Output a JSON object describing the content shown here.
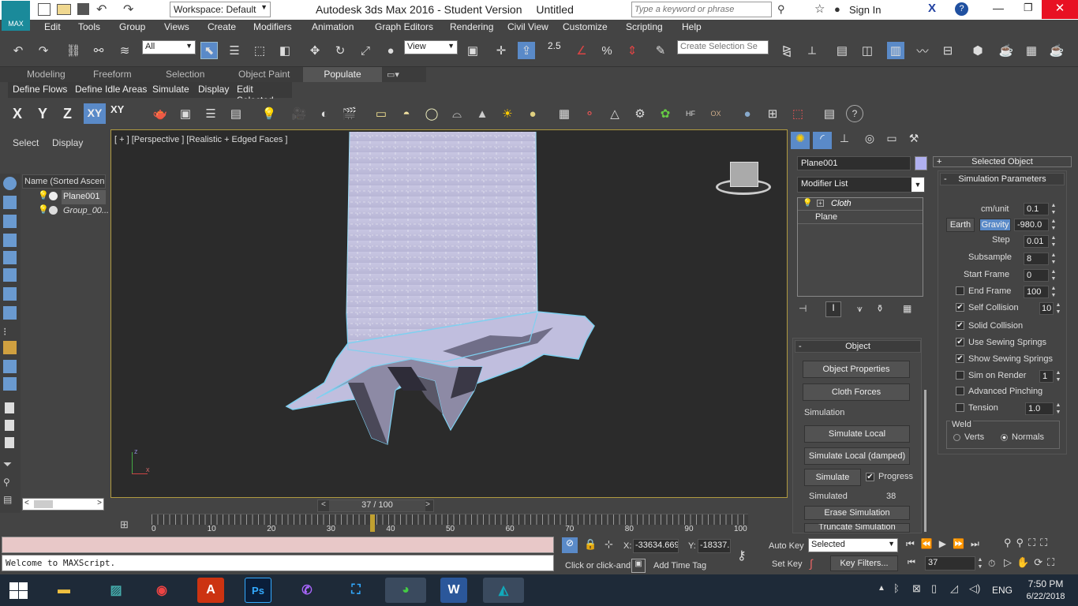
{
  "title_bar": {
    "workspace_label": "Workspace: Default",
    "app_title": "Autodesk 3ds Max 2016 - Student Version",
    "file_name": "Untitled",
    "search_placeholder": "Type a keyword or phrase",
    "sign_in": "Sign In",
    "app_logo": "MAX"
  },
  "menu": [
    "Edit",
    "Tools",
    "Group",
    "Views",
    "Create",
    "Modifiers",
    "Animation",
    "Graph Editors",
    "Rendering",
    "Civil View",
    "Customize",
    "Scripting",
    "Help"
  ],
  "toolbar": {
    "filter_value": "All",
    "refcoord_value": "View",
    "selection_set_placeholder": "Create Selection Se",
    "snap_label": "2.5"
  },
  "ribbon": {
    "tabs": [
      "Modeling",
      "Freeform",
      "Selection",
      "Object Paint",
      "Populate"
    ],
    "active_tab": "Populate",
    "sub_items": [
      "Define Flows",
      "Define Idle Areas",
      "Simulate",
      "Display",
      "Edit Selected"
    ]
  },
  "axis_constraints": [
    "X",
    "Y",
    "Z",
    "XY",
    "XY"
  ],
  "scene_explorer": {
    "tabs": [
      "Select",
      "Display"
    ],
    "column_header": "Name (Sorted Ascend",
    "items": [
      "Plane001",
      "Group_00..."
    ]
  },
  "viewport": {
    "label": "[ + ] [Perspective ] [Realistic + Edged Faces ]",
    "axis_x": "x",
    "axis_z": "z"
  },
  "command_panel": {
    "object_name": "Plane001",
    "modifier_list": "Modifier List",
    "stack": [
      "Cloth",
      "Plane"
    ],
    "object_rollout": "Object",
    "buttons": {
      "object_properties": "Object Properties",
      "cloth_forces": "Cloth Forces",
      "simulate_local": "Simulate Local",
      "simulate_local_damped": "Simulate Local (damped)",
      "simulate": "Simulate",
      "erase_simulation": "Erase Simulation",
      "truncate_simulation": "Truncate Simulation"
    },
    "simulation_group": "Simulation",
    "progress_label": "Progress",
    "simulated_label": "Simulated",
    "simulated_value": "38"
  },
  "params_panel": {
    "selected_object": "Selected Object",
    "simulation_parameters": "Simulation Parameters",
    "cm_unit_label": "cm/unit",
    "cm_unit_value": "0.1",
    "earth_label": "Earth",
    "gravity_label": "Gravity",
    "gravity_value": "-980.0",
    "step_label": "Step",
    "step_value": "0.01",
    "subsample_label": "Subsample",
    "subsample_value": "8",
    "start_frame_label": "Start Frame",
    "start_frame_value": "0",
    "end_frame_label": "End Frame",
    "end_frame_value": "100",
    "self_collision_label": "Self Collision",
    "self_collision_value": "10",
    "solid_collision_label": "Solid Collision",
    "use_sewing_label": "Use Sewing Springs",
    "show_sewing_label": "Show Sewing Springs",
    "sim_on_render_label": "Sim on Render",
    "sim_on_render_value": "1",
    "advanced_pinching_label": "Advanced Pinching",
    "tension_label": "Tension",
    "tension_value": "1.0",
    "weld_label": "Weld",
    "verts_label": "Verts",
    "normals_label": "Normals"
  },
  "timeline": {
    "frame_display": "37 / 100",
    "ticks": [
      "0",
      "10",
      "20",
      "30",
      "40",
      "50",
      "60",
      "70",
      "80",
      "90",
      "100"
    ],
    "current_frame_ratio": 0.37
  },
  "status": {
    "maxscript_output": "Welcome to MAXScript.",
    "x_label": "X:",
    "x_value": "-33634.669",
    "y_label": "Y:",
    "y_value": "-18337.",
    "prompt": "Click or click-and",
    "add_time_tag": "Add Time Tag",
    "auto_key": "Auto Key",
    "set_key": "Set Key",
    "key_mode": "Selected",
    "key_filters": "Key Filters...",
    "current_frame": "37"
  },
  "taskbar": {
    "language": "ENG",
    "time": "7:50 PM",
    "date": "6/22/2018"
  }
}
